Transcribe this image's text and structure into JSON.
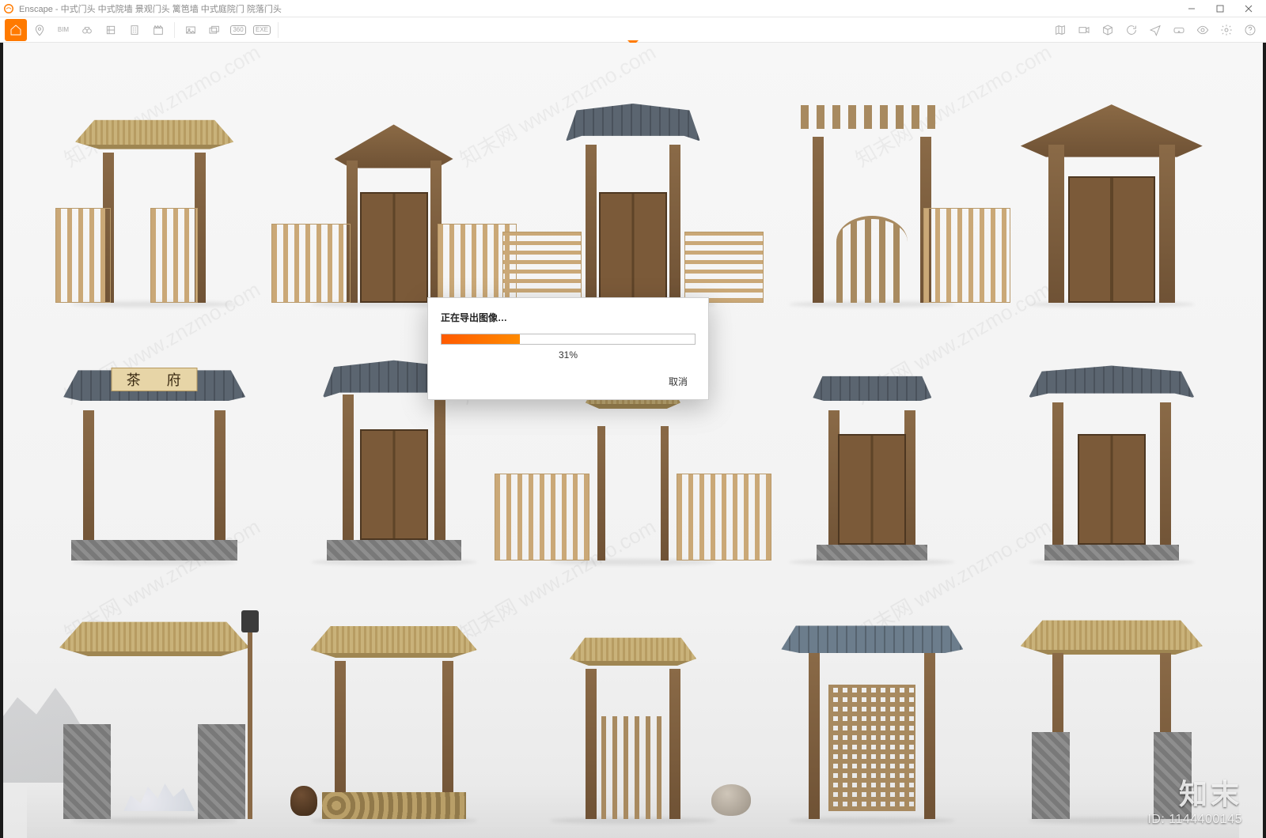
{
  "window": {
    "app": "Enscape",
    "title": "Enscape - 中式门头 中式院墙 景观门头 篱笆墙 中式庭院门 院落门头"
  },
  "toolbar": {
    "left": [
      {
        "name": "home-button",
        "label": "",
        "active": true
      },
      {
        "name": "location-pin-button",
        "label": ""
      },
      {
        "name": "bim-button",
        "label": "BIM"
      },
      {
        "name": "binoculars-button",
        "label": ""
      },
      {
        "name": "asset-library-button",
        "label": ""
      },
      {
        "name": "building-button",
        "label": ""
      },
      {
        "name": "clapperboard-button",
        "label": ""
      }
    ],
    "middle": [
      {
        "name": "export-image-button",
        "label": ""
      },
      {
        "name": "export-batch-button",
        "label": ""
      },
      {
        "name": "panorama-360-button",
        "label": "360"
      },
      {
        "name": "export-exe-button",
        "label": "EXE"
      }
    ],
    "right": [
      {
        "name": "map-button",
        "label": ""
      },
      {
        "name": "video-settings-button",
        "label": ""
      },
      {
        "name": "view-cube-button",
        "label": ""
      },
      {
        "name": "sync-button",
        "label": ""
      },
      {
        "name": "paper-plane-button",
        "label": ""
      },
      {
        "name": "vr-headset-button",
        "label": ""
      },
      {
        "name": "visual-settings-button",
        "label": ""
      },
      {
        "name": "settings-gear-button",
        "label": ""
      },
      {
        "name": "help-button",
        "label": ""
      }
    ]
  },
  "export_dialog": {
    "title": "正在导出图像…",
    "percent": 31,
    "percent_label": "31%",
    "cancel": "取消"
  },
  "viewport": {
    "gate_sign_text": "茶 府"
  },
  "watermark": {
    "tile_text": "知末网 www.znzmo.com",
    "brand_name": "知末",
    "id_label": "ID: 1144400145"
  },
  "colors": {
    "accent": "#ff7a00"
  }
}
